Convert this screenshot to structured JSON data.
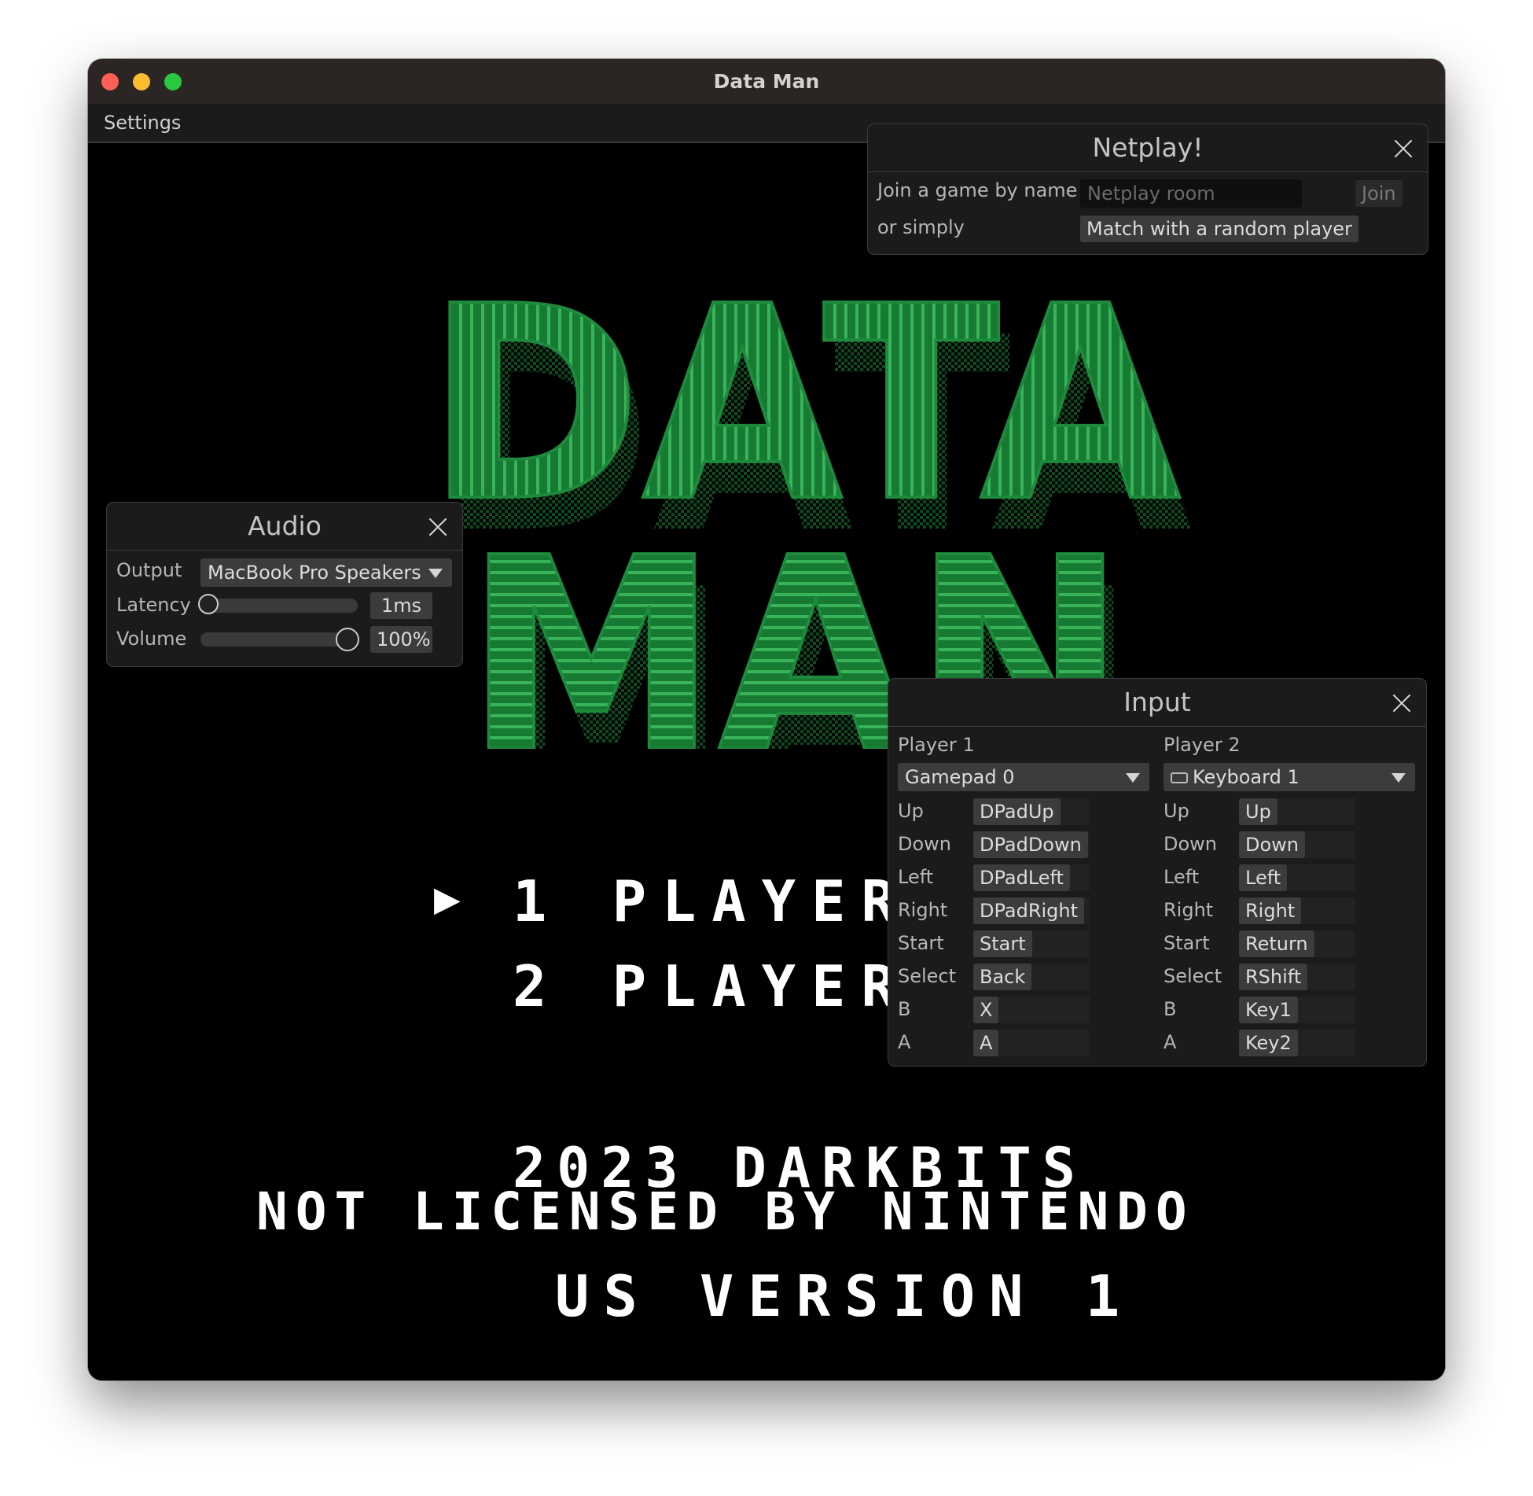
{
  "window": {
    "title": "Data Man"
  },
  "menu": {
    "settings": "Settings"
  },
  "game": {
    "logo_top": "DATA",
    "logo_bottom": "MAN",
    "cursor": "▶",
    "menu_1": "1 PLAYER",
    "menu_2": "2 PLAYER",
    "copyright": "2023 DARKBITS",
    "license": "NOT LICENSED BY NINTENDO",
    "version": "US VERSION 1",
    "logo_color": "#1e8a3c"
  },
  "netplay": {
    "title": "Netplay!",
    "join_label": "Join a game by name",
    "room_placeholder": "Netplay room",
    "join_button": "Join",
    "or_label": "or simply",
    "match_button": "Match with a random player"
  },
  "audio": {
    "title": "Audio",
    "output_label": "Output",
    "output_value": "MacBook Pro Speakers",
    "latency_label": "Latency",
    "latency_value": "1ms",
    "volume_label": "Volume",
    "volume_value": "100%"
  },
  "input": {
    "title": "Input",
    "player1": {
      "label": "Player 1",
      "device": "Gamepad 0",
      "bindings": [
        {
          "action": "Up",
          "key": "DPadUp"
        },
        {
          "action": "Down",
          "key": "DPadDown"
        },
        {
          "action": "Left",
          "key": "DPadLeft"
        },
        {
          "action": "Right",
          "key": "DPadRight"
        },
        {
          "action": "Start",
          "key": "Start"
        },
        {
          "action": "Select",
          "key": "Back"
        },
        {
          "action": "B",
          "key": "X"
        },
        {
          "action": "A",
          "key": "A"
        }
      ]
    },
    "player2": {
      "label": "Player 2",
      "device": "Keyboard 1",
      "device_icon": "keyboard-icon",
      "bindings": [
        {
          "action": "Up",
          "key": "Up"
        },
        {
          "action": "Down",
          "key": "Down"
        },
        {
          "action": "Left",
          "key": "Left"
        },
        {
          "action": "Right",
          "key": "Right"
        },
        {
          "action": "Start",
          "key": "Return"
        },
        {
          "action": "Select",
          "key": "RShift"
        },
        {
          "action": "B",
          "key": "Key1"
        },
        {
          "action": "A",
          "key": "Key2"
        }
      ]
    }
  }
}
